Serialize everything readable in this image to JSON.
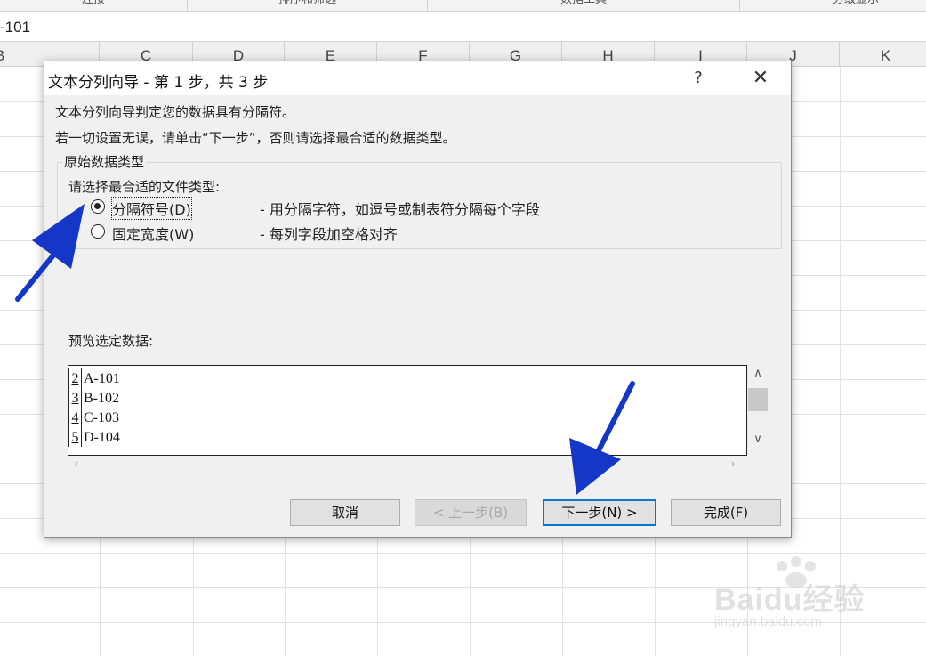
{
  "ribbon": {
    "groups": [
      "连接",
      "排序和筛选",
      "数据工具",
      "分级显示"
    ]
  },
  "formula_bar": {
    "value": "-101"
  },
  "columns": [
    "B",
    "C",
    "D",
    "E",
    "F",
    "G",
    "H",
    "I",
    "J",
    "K"
  ],
  "dialog": {
    "title": "文本分列向导 - 第 1 步，共 3 步",
    "help_label": "?",
    "close_label": "✕",
    "desc_line1": "文本分列向导判定您的数据具有分隔符。",
    "desc_line2": "若一切设置无误，请单击“下一步”，否则请选择最合适的数据类型。",
    "group_title": "原始数据类型",
    "prompt": "请选择最合适的文件类型:",
    "options": [
      {
        "label": "分隔符号(D)",
        "desc": "- 用分隔字符，如逗号或制表符分隔每个字段",
        "selected": true
      },
      {
        "label": "固定宽度(W)",
        "desc": "- 每列字段加空格对齐",
        "selected": false
      }
    ],
    "preview_label": "预览选定数据:",
    "preview_rows": [
      {
        "num": "2",
        "text": "A-101"
      },
      {
        "num": "3",
        "text": "B-102"
      },
      {
        "num": "4",
        "text": "C-103"
      },
      {
        "num": "5",
        "text": "D-104"
      }
    ],
    "buttons": {
      "cancel": "取消",
      "back": "< 上一步(B)",
      "next": "下一步(N) >",
      "finish": "完成(F)"
    }
  },
  "annotation_color": "#1437c8",
  "watermark": {
    "brand": "Baidu经验",
    "url": "jingyan.baidu.com"
  }
}
